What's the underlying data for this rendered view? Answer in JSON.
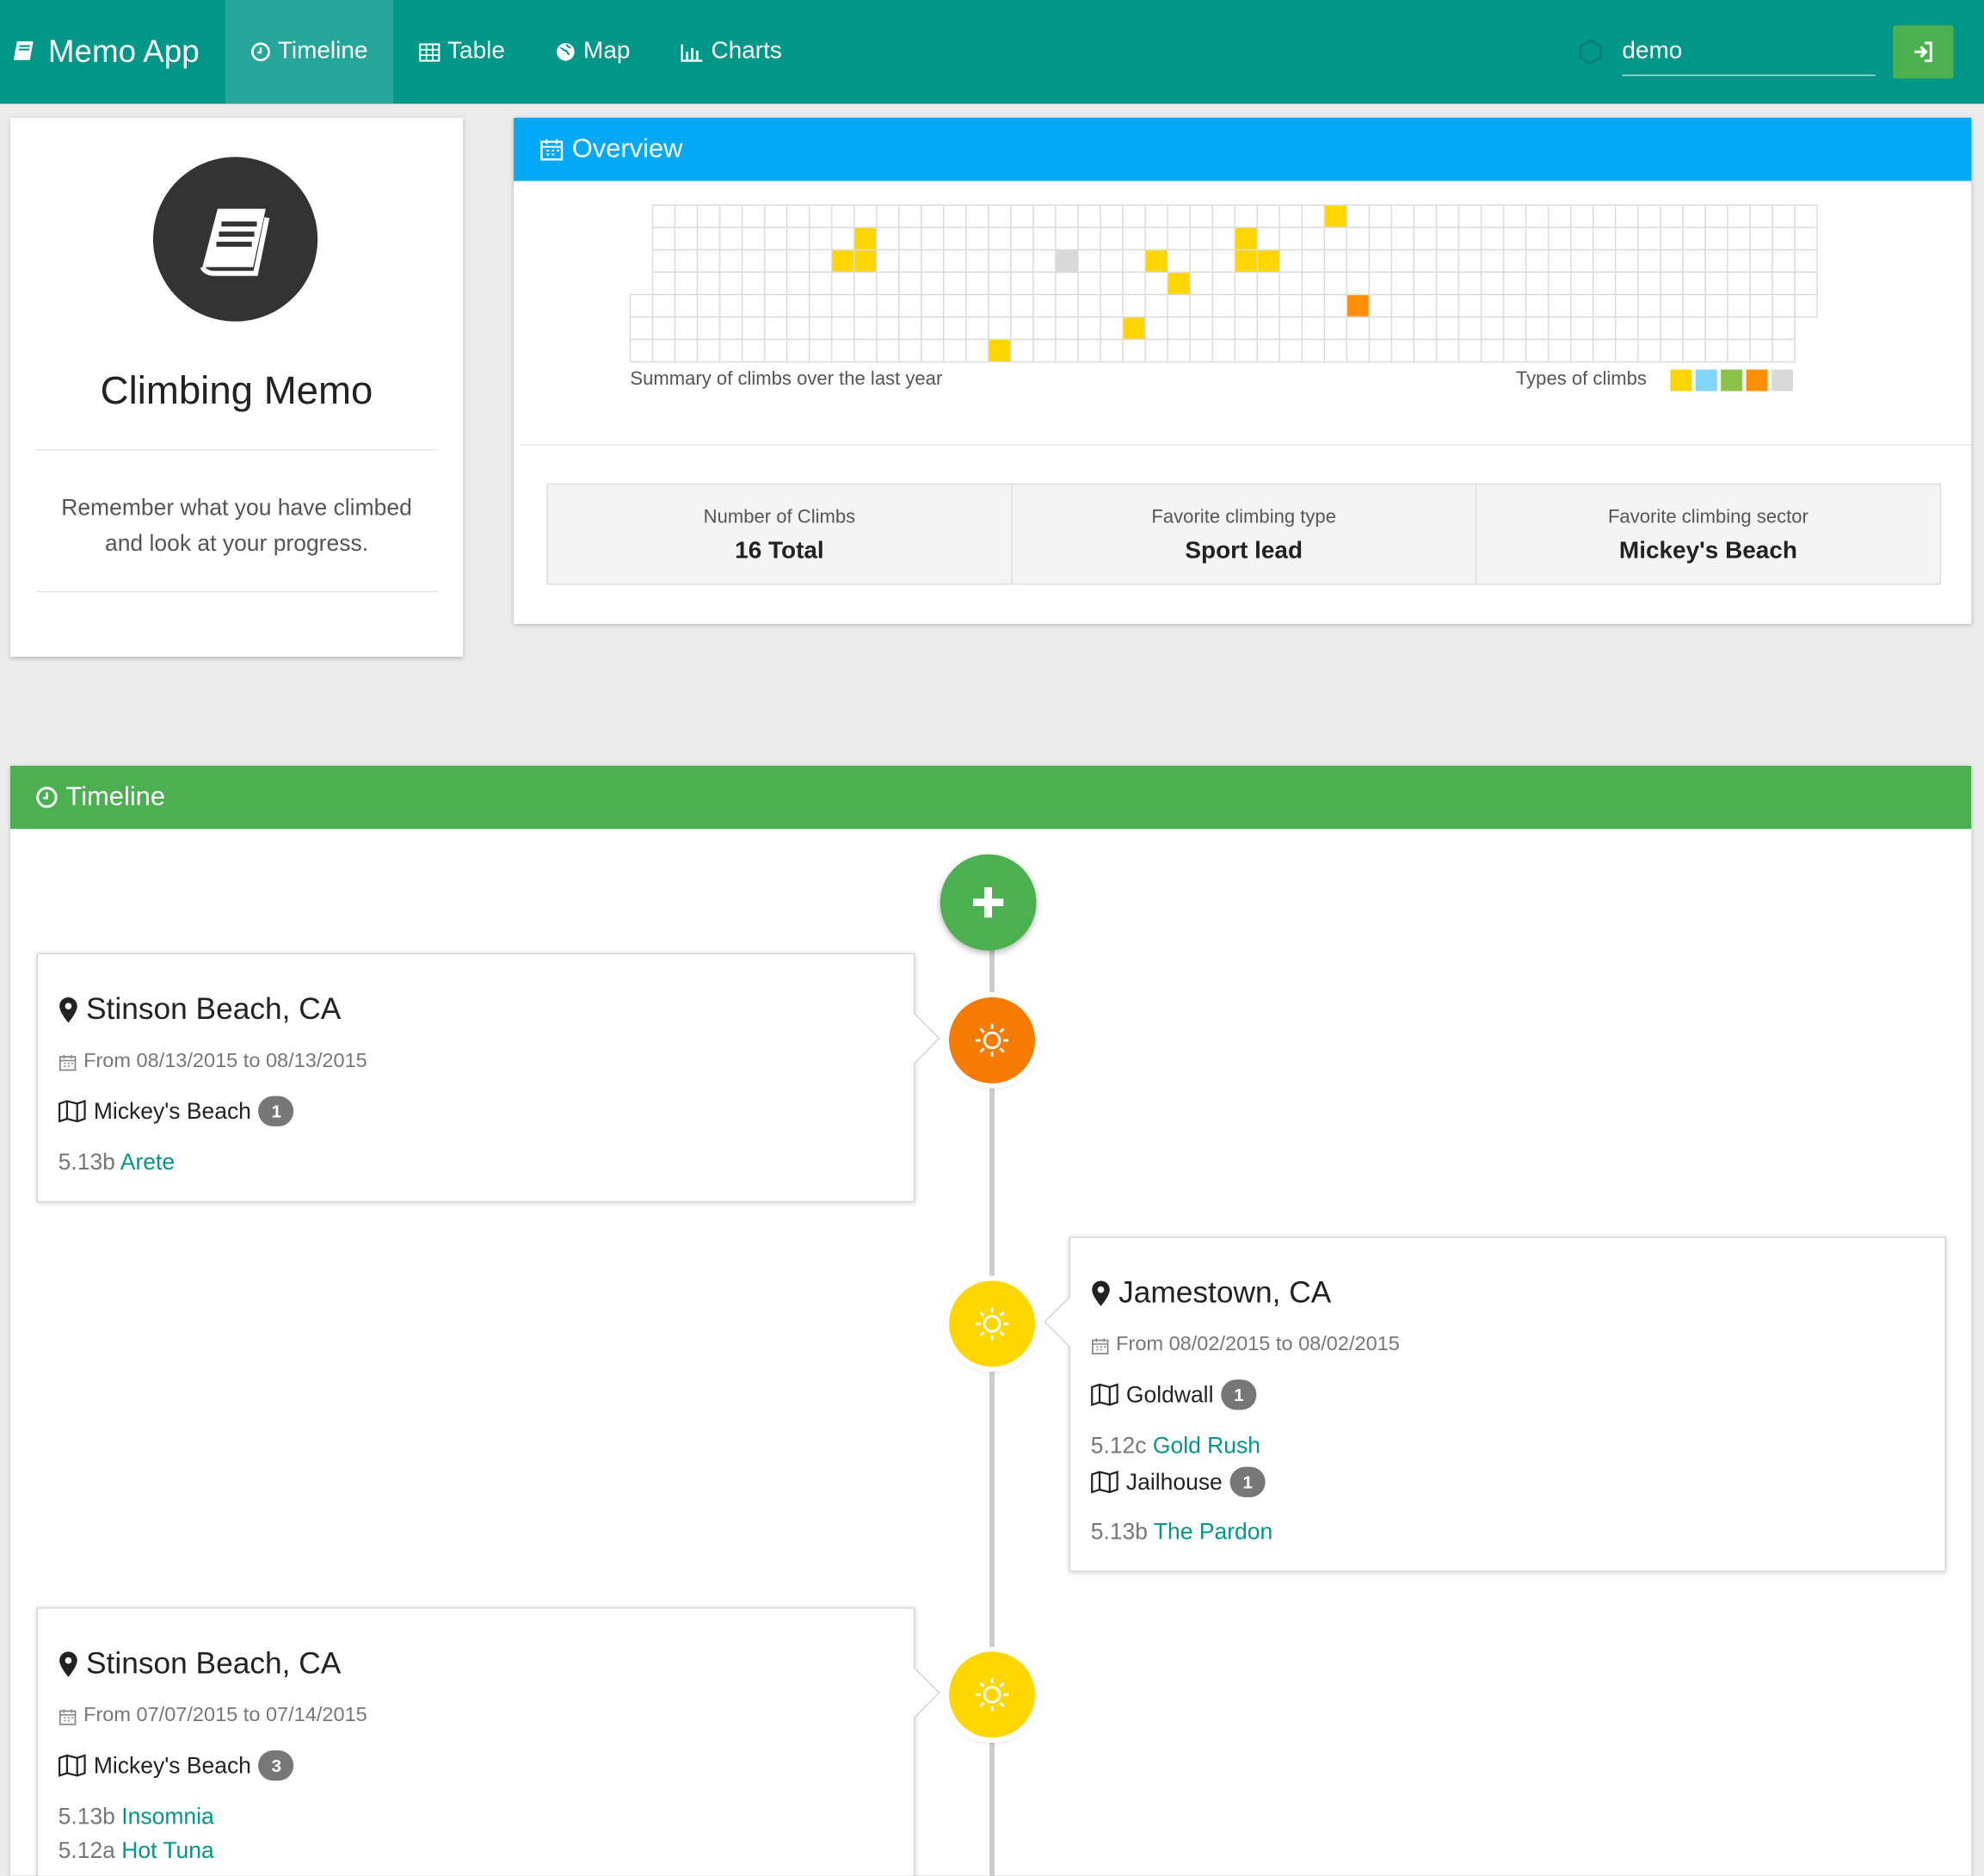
{
  "navbar": {
    "brand": "Memo App",
    "items": [
      {
        "label": "Timeline",
        "icon": "clock-icon",
        "active": true
      },
      {
        "label": "Table",
        "icon": "table-icon",
        "active": false
      },
      {
        "label": "Map",
        "icon": "globe-icon",
        "active": false
      },
      {
        "label": "Charts",
        "icon": "bar-chart-icon",
        "active": false
      }
    ],
    "user_value": "demo",
    "login_icon": "sign-in-icon"
  },
  "profile": {
    "title": "Climbing Memo",
    "description": "Remember what you have climbed and look at your progress."
  },
  "overview": {
    "title": "Overview",
    "summary_caption": "Summary of climbs over the last year",
    "types_caption": "Types of climbs",
    "type_colors": [
      "#ffd500",
      "#81d4fa",
      "#8bc34a",
      "#ff8f00",
      "#d9d9d9"
    ],
    "stats": [
      {
        "label": "Number of Climbs",
        "value": "16 Total"
      },
      {
        "label": "Favorite climbing type",
        "value": "Sport lead"
      },
      {
        "label": "Favorite climbing sector",
        "value": "Mickey's Beach"
      }
    ]
  },
  "timeline": {
    "title": "Timeline",
    "entries": [
      {
        "location": "Stinson Beach, CA",
        "date": "From 08/13/2015 to 08/13/2015",
        "color": "#f57c00",
        "sectors": [
          {
            "name": "Mickey's Beach",
            "count": "1",
            "routes": [
              {
                "grade": "5.13b",
                "name": "Arete"
              }
            ]
          }
        ]
      },
      {
        "location": "Jamestown, CA",
        "date": "From 08/02/2015 to 08/02/2015",
        "color": "#ffd600",
        "sectors": [
          {
            "name": "Goldwall",
            "count": "1",
            "routes": [
              {
                "grade": "5.12c",
                "name": "Gold Rush"
              }
            ]
          },
          {
            "name": "Jailhouse",
            "count": "1",
            "routes": [
              {
                "grade": "5.13b",
                "name": "The Pardon"
              }
            ]
          }
        ]
      },
      {
        "location": "Stinson Beach, CA",
        "date": "From 07/07/2015 to 07/14/2015",
        "color": "#ffd600",
        "sectors": [
          {
            "name": "Mickey's Beach",
            "count": "3",
            "routes": [
              {
                "grade": "5.13b",
                "name": "Insomnia"
              },
              {
                "grade": "5.12a",
                "name": "Hot Tuna"
              }
            ]
          }
        ]
      }
    ]
  }
}
